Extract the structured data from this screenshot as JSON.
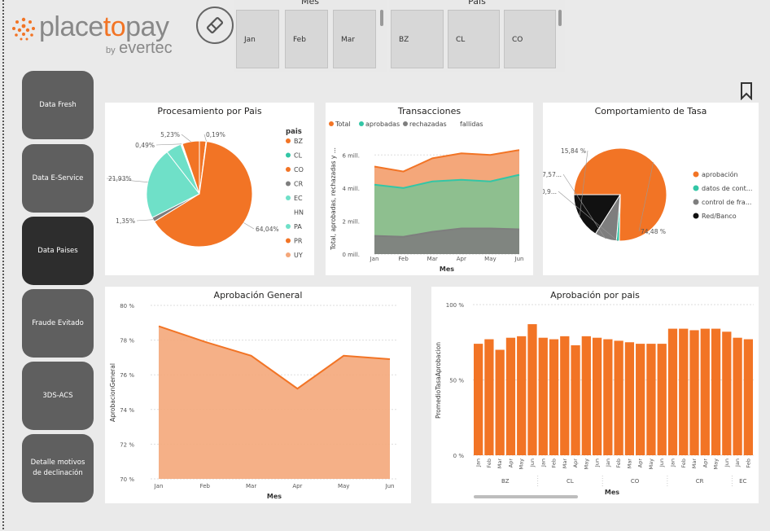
{
  "brand": {
    "name_a": "place",
    "name_b": "to",
    "name_c": "pay",
    "by": "by",
    "parent": "evertec"
  },
  "colors": {
    "orange": "#f27425",
    "light_orange": "#f4a77a",
    "teal": "#33c6a6",
    "aqua": "#6fe0c8",
    "gray": "#7e7e7e",
    "green_area": "#8ebf8f",
    "black": "#111111"
  },
  "slicers": {
    "mes": {
      "title": "Mes",
      "items": [
        "Jan",
        "Feb",
        "Mar"
      ]
    },
    "pais": {
      "title": "Pais",
      "items": [
        "BZ",
        "CL",
        "CO"
      ]
    }
  },
  "nav": [
    {
      "label": "Data Fresh"
    },
    {
      "label": "Data E-Service"
    },
    {
      "label": "Data Paises"
    },
    {
      "label": "Fraude Evitado"
    },
    {
      "label": "3DS-ACS"
    },
    {
      "label": "Detalle motivos de declinación"
    }
  ],
  "icons": {
    "clear": "eraser-icon",
    "bookmark": "bookmark-icon"
  },
  "chart_data": [
    {
      "type": "pie",
      "title": "Procesamiento por Pais",
      "legend_title": "pais",
      "legend_position": "right",
      "slices": [
        {
          "label": "BZ",
          "value": 2.0,
          "color": "#f27425"
        },
        {
          "label": "CL",
          "value": 0.19,
          "color": "#33c6a6"
        },
        {
          "label": "CO",
          "value": 64.04,
          "color": "#f27425"
        },
        {
          "label": "CR",
          "value": 1.35,
          "color": "#7e7e7e"
        },
        {
          "label": "EC",
          "value": 21.93,
          "color": "#6fe0c8"
        },
        {
          "label": "HN",
          "value": 0.49,
          "color": "#ffffff"
        },
        {
          "label": "PA",
          "value": 4.77,
          "color": "#6fe0c8"
        },
        {
          "label": "PR",
          "value": 5.23,
          "color": "#f27425"
        },
        {
          "label": "UY",
          "value": 0.0,
          "color": "#f4a77a"
        }
      ],
      "data_labels": [
        "0,19%",
        "5,23%",
        "0,49%",
        "21,93%",
        "1,35%",
        "64,04%"
      ]
    },
    {
      "type": "area",
      "title": "Transacciones",
      "legend_position": "top-left",
      "legend": [
        "Total",
        "aprobadas",
        "rechazadas",
        "fallidas"
      ],
      "x": [
        "Jan",
        "Feb",
        "Mar",
        "Apr",
        "May",
        "Jun"
      ],
      "xlabel": "Mes",
      "ylabel": "Total, aprobadas, rechazadas y ...",
      "ylim": [
        0,
        7
      ],
      "yticks": [
        "0 mill.",
        "2 mill.",
        "4 mill.",
        "6 mill."
      ],
      "series": [
        {
          "name": "Total",
          "values": [
            5.3,
            5.0,
            5.8,
            6.1,
            6.0,
            6.3
          ]
        },
        {
          "name": "aprobadas",
          "values": [
            4.2,
            4.0,
            4.4,
            4.5,
            4.4,
            4.8
          ]
        },
        {
          "name": "rechazadas",
          "values": [
            1.1,
            1.05,
            1.35,
            1.55,
            1.55,
            1.5
          ]
        },
        {
          "name": "fallidas",
          "values": [
            0,
            0,
            0,
            0,
            0,
            0
          ]
        }
      ]
    },
    {
      "type": "pie",
      "title": "Comportamiento de Tasa",
      "legend_position": "right",
      "slices": [
        {
          "label": "aprobación",
          "value": 74.48,
          "color": "#f27425"
        },
        {
          "label": "datos de cont...",
          "value": 1.0,
          "color": "#33c6a6"
        },
        {
          "label": "control de fra...",
          "value": 7.57,
          "color": "#7e7e7e"
        },
        {
          "label": "Red/Banco",
          "value": 15.84,
          "color": "#111111"
        }
      ],
      "data_labels": [
        "15,84 %",
        "7,57...",
        "0,9...",
        "74,48 %"
      ]
    },
    {
      "type": "area",
      "title": "Aprobación General",
      "x": [
        "Jan",
        "Feb",
        "Mar",
        "Apr",
        "May",
        "Jun"
      ],
      "xlabel": "Mes",
      "ylabel": "AprobacionGeneral",
      "ylim": [
        70,
        80
      ],
      "yticks": [
        "70 %",
        "72 %",
        "74 %",
        "76 %",
        "78 %",
        "80 %"
      ],
      "values": [
        78.8,
        77.9,
        77.1,
        75.2,
        77.1,
        76.9
      ]
    },
    {
      "type": "bar",
      "title": "Aprobación por pais",
      "xlabel": "Mes",
      "ylabel": "PromedioTasaAprobacion",
      "ylim": [
        0,
        100
      ],
      "yticks": [
        "0 %",
        "50 %",
        "100 %"
      ],
      "categories": [
        "Jan",
        "Feb",
        "Mar",
        "Apr",
        "May",
        "Jun",
        "Jan",
        "Feb",
        "Mar",
        "Apr",
        "May",
        "Jun",
        "Jan",
        "Feb",
        "Mar",
        "Apr",
        "May",
        "Jun",
        "Jan",
        "Feb",
        "Mar",
        "Apr",
        "May",
        "Jun",
        "Jan",
        "Feb"
      ],
      "groups": [
        {
          "label": "BZ",
          "count": 6
        },
        {
          "label": "CL",
          "count": 6
        },
        {
          "label": "CO",
          "count": 6
        },
        {
          "label": "CR",
          "count": 6
        },
        {
          "label": "EC",
          "count": 2
        }
      ],
      "values": [
        74,
        77,
        70,
        78,
        79,
        87,
        78,
        77,
        79,
        73,
        79,
        78,
        77,
        76,
        75,
        74,
        74,
        74,
        84,
        84,
        83,
        84,
        84,
        82,
        78,
        77
      ]
    }
  ]
}
